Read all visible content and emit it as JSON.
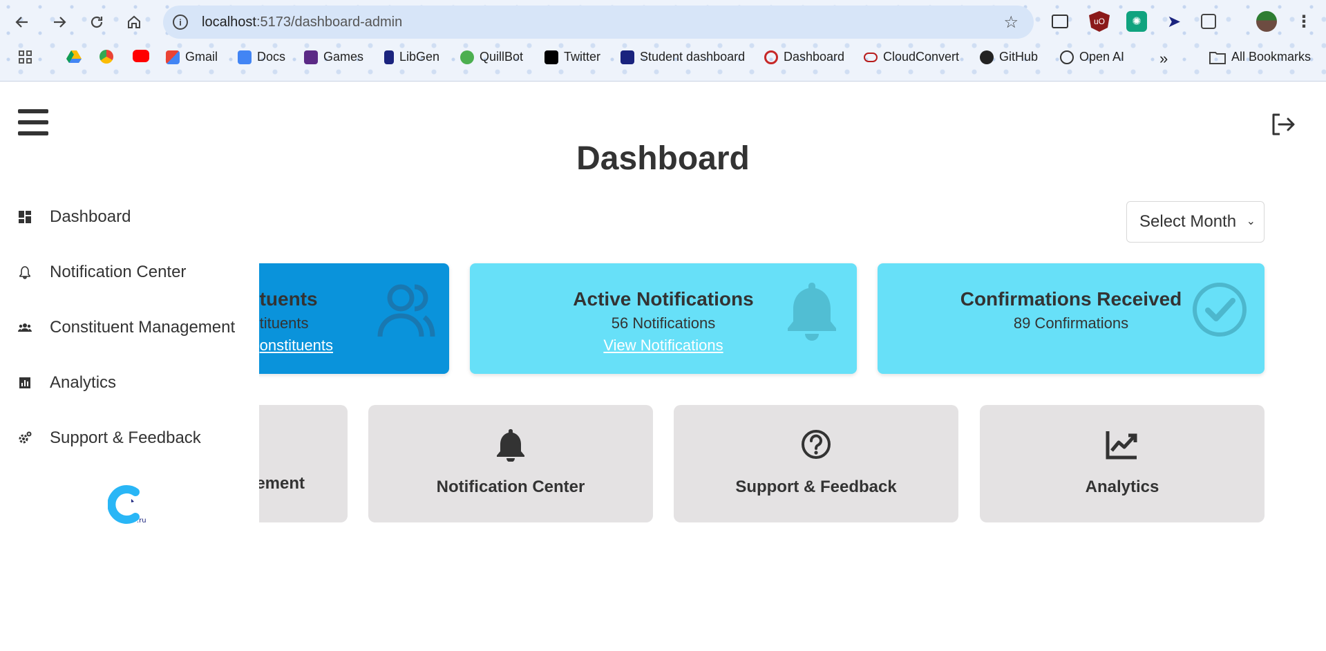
{
  "browser": {
    "url_host": "localhost",
    "url_path": ":5173/dashboard-admin",
    "bookmarks": [
      {
        "label": "Gmail",
        "color": "#d93025"
      },
      {
        "label": "Docs",
        "color": "#4285f4"
      },
      {
        "label": "Games",
        "color": "#5b2a86"
      },
      {
        "label": "LibGen",
        "color": "#1a237e"
      },
      {
        "label": "QuillBot",
        "color": "#4caf50"
      },
      {
        "label": "Twitter",
        "color": "#000000"
      },
      {
        "label": "Student dashboard",
        "color": "#1a237e"
      },
      {
        "label": "Dashboard",
        "color": "#c62828"
      },
      {
        "label": "CloudConvert",
        "color": "#b71c1c"
      },
      {
        "label": "GitHub",
        "color": "#222222"
      },
      {
        "label": "Open AI",
        "color": "#333333"
      }
    ],
    "overflow": "»",
    "all_bookmarks": "All Bookmarks"
  },
  "page": {
    "title": "Dashboard",
    "select_month": "Select Month"
  },
  "stat_cards": [
    {
      "title": "tuents",
      "subtitle": "tituents",
      "link": "onstituents",
      "color": "#0a93db",
      "icon": "users-icon"
    },
    {
      "title": "Active Notifications",
      "subtitle": "56 Notifications",
      "link": "View Notifications",
      "color": "#67e0f8",
      "icon": "bell-icon"
    },
    {
      "title": "Confirmations Received",
      "subtitle": "89 Confirmations",
      "link": "",
      "color": "#67e0f8",
      "icon": "check-circle-icon"
    }
  ],
  "nav_cards": [
    {
      "label": "ement",
      "icon": ""
    },
    {
      "label": "Notification Center",
      "icon": "bell-icon"
    },
    {
      "label": "Support & Feedback",
      "icon": "question-circle-icon"
    },
    {
      "label": "Analytics",
      "icon": "chart-line-icon"
    }
  ],
  "sidebar": {
    "items": [
      {
        "label": "Dashboard",
        "icon": "dashboard-icon"
      },
      {
        "label": "Notification Center",
        "icon": "bell-icon"
      },
      {
        "label": "Constituent Management",
        "icon": "users-icon"
      },
      {
        "label": "Analytics",
        "icon": "chart-icon"
      },
      {
        "label": "Support & Feedback",
        "icon": "gear-icon"
      }
    ],
    "logo_text": ".ru"
  }
}
